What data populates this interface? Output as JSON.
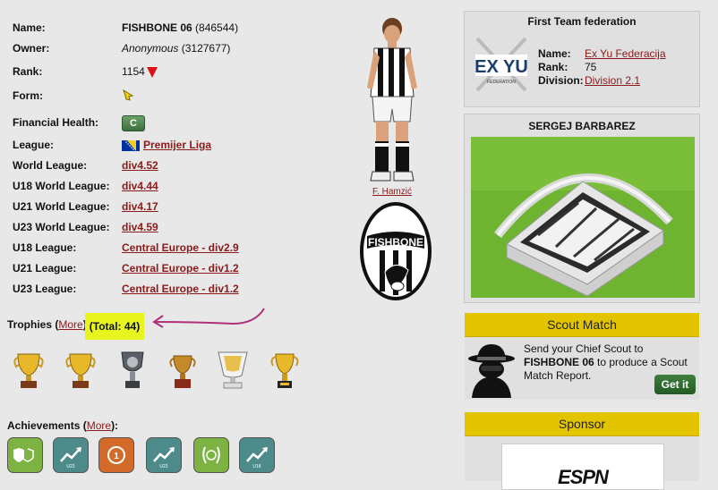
{
  "team": {
    "name_label": "Name:",
    "name": "FISHBONE 06",
    "team_id": "(846544)",
    "owner_label": "Owner:",
    "owner": "Anonymous",
    "owner_id": "(3127677)",
    "rank_label": "Rank:",
    "rank": "1154",
    "rank_trend": "down",
    "form_label": "Form:",
    "form_icon": "arrow-down-left-icon",
    "health_label": "Financial Health:",
    "health": "C",
    "league_label": "League:",
    "league": "Premijer Liga",
    "league_flag": "bosnia-flag",
    "world_label": "World League:",
    "world": "div4.52",
    "u18w_label": "U18 World League:",
    "u18w": "div4.44",
    "u21w_label": "U21 World League:",
    "u21w": "div4.17",
    "u23w_label": "U23 World League:",
    "u23w": "div4.59",
    "u18l_label": "U18 League:",
    "u18l": "Central Europe - div2.9",
    "u21l_label": "U21 League:",
    "u21l": "Central Europe - div1.2",
    "u23l_label": "U23 League:",
    "u23l": "Central Europe - div1.2"
  },
  "player": {
    "name": "F. Hamzić"
  },
  "club_logo": {
    "text": "FISHBONE"
  },
  "trophies": {
    "title": "Trophies",
    "more": "More",
    "total": "(Total: 44)",
    "icons": [
      "gold-cup-icon",
      "gold-cup-icon",
      "silver-shield-cup-icon",
      "bronze-cup-icon",
      "white-gold-cup-icon",
      "gold-cup-icon"
    ]
  },
  "achievements": {
    "title": "Achievements",
    "more": "More",
    "icons": [
      "shield-badge-icon",
      "growth-u23-icon",
      "medal-1-icon",
      "growth-u23-icon",
      "laurel-badge-icon",
      "growth-u18-icon"
    ]
  },
  "federation": {
    "title": "First Team federation",
    "logo_text": "EX YU",
    "logo_sub": "FEDERATION",
    "name_label": "Name:",
    "name": "Ex Yu Federacija",
    "rank_label": "Rank:",
    "rank": "75",
    "division_label": "Division:",
    "division": "Division 2.1"
  },
  "stadium": {
    "title": "SERGEJ BARBAREZ"
  },
  "scout": {
    "title": "Scout Match",
    "text_pre": "Send your Chief Scout to ",
    "team": "FISHBONE 06",
    "text_post": " to produce a Scout Match Report.",
    "button": "Get it"
  },
  "sponsor": {
    "title": "Sponsor",
    "brand": "ESPN"
  },
  "colors": {
    "link": "#8b1a1a",
    "highlight": "#e8f51f",
    "panel_header": "#e3c400",
    "annotation": "#b0307a"
  }
}
